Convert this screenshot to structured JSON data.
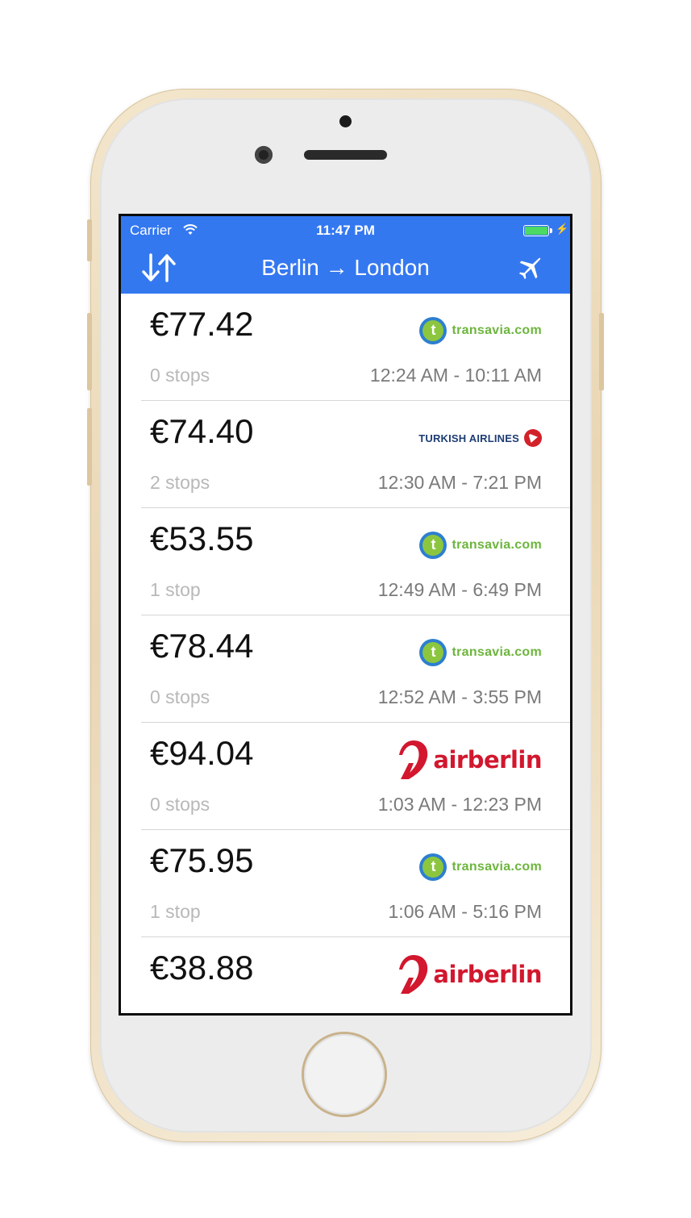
{
  "status_bar": {
    "carrier": "Carrier",
    "time": "11:47 PM",
    "battery_level": 1.0
  },
  "nav": {
    "title": "Berlin → London",
    "left_icon": "sort-arrows-icon",
    "right_icon": "airplane-icon"
  },
  "colors": {
    "accent": "#3478f0",
    "battery": "#4cd964",
    "airberlin_red": "#d2172e",
    "transavia_green": "#6db53d",
    "turkish_red": "#d3212a"
  },
  "airlines": {
    "transavia": "transavia.com",
    "turkish": "TURKISH AIRLINES",
    "airberlin": "airberlin"
  },
  "flights": [
    {
      "price": "€77.42",
      "stops": "0 stops",
      "times": "12:24 AM - 10:11 AM",
      "airline": "transavia"
    },
    {
      "price": "€74.40",
      "stops": "2 stops",
      "times": "12:30 AM - 7:21 PM",
      "airline": "turkish"
    },
    {
      "price": "€53.55",
      "stops": "1 stop",
      "times": "12:49 AM - 6:49 PM",
      "airline": "transavia"
    },
    {
      "price": "€78.44",
      "stops": "0 stops",
      "times": "12:52 AM - 3:55 PM",
      "airline": "transavia"
    },
    {
      "price": "€94.04",
      "stops": "0 stops",
      "times": "1:03 AM - 12:23 PM",
      "airline": "airberlin"
    },
    {
      "price": "€75.95",
      "stops": "1 stop",
      "times": "1:06 AM - 5:16 PM",
      "airline": "transavia"
    },
    {
      "price": "€38.88",
      "stops": "",
      "times": "",
      "airline": "airberlin"
    }
  ]
}
